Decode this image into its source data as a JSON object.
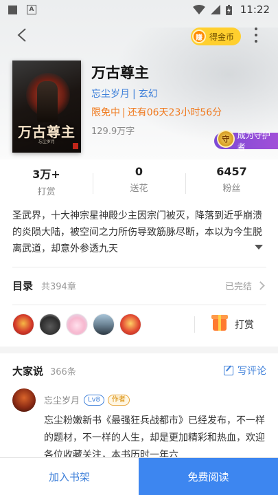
{
  "status": {
    "time": "11:22"
  },
  "header": {
    "coin_label": "得金币",
    "coin_glyph": "赚"
  },
  "book": {
    "cover_title": "万古尊主",
    "cover_author": "忘尘岁月",
    "title": "万古尊主",
    "author": "忘尘岁月",
    "genre": "玄幻",
    "meta_sep": "|",
    "free_label": "限免中",
    "free_remaining": "还有06天23小时56分",
    "words": "129.9万字",
    "guardian_label": "成为守护者",
    "guardian_glyph": "守"
  },
  "stats": [
    {
      "value": "3万+",
      "label": "打赏"
    },
    {
      "value": "0",
      "label": "送花"
    },
    {
      "value": "6457",
      "label": "粉丝"
    }
  ],
  "description": "圣武界，十大神宗星神殿少主因宗门被灭，降落到近乎崩溃的炎陨大陆，被空间之力所伤导致筋脉尽断，本以为今生脱离武道，却意外参透九天",
  "toc": {
    "title": "目录",
    "count": "共394章",
    "status": "已完结"
  },
  "fans": {
    "tip_label": "打赏"
  },
  "comments": {
    "title": "大家说",
    "count": "366条",
    "write_label": "写评论",
    "items": [
      {
        "user": "忘尘岁月",
        "level": "Lv8",
        "badge": "作者",
        "text": "忘尘粉嫩新书《最强狂兵战都市》已经发布，不一样的题材，不一样的人生，却是更加精彩和热血，欢迎各位收藏关注，本书历时一年六"
      }
    ]
  },
  "bottom": {
    "shelf_label": "加入书架",
    "read_label": "免费阅读"
  },
  "colors": {
    "accent": "#3d7fd9",
    "free": "#f07a1f",
    "read_button": "#3d86f0",
    "coin": "#ffcf2e",
    "guardian": "#8b4dd6"
  }
}
